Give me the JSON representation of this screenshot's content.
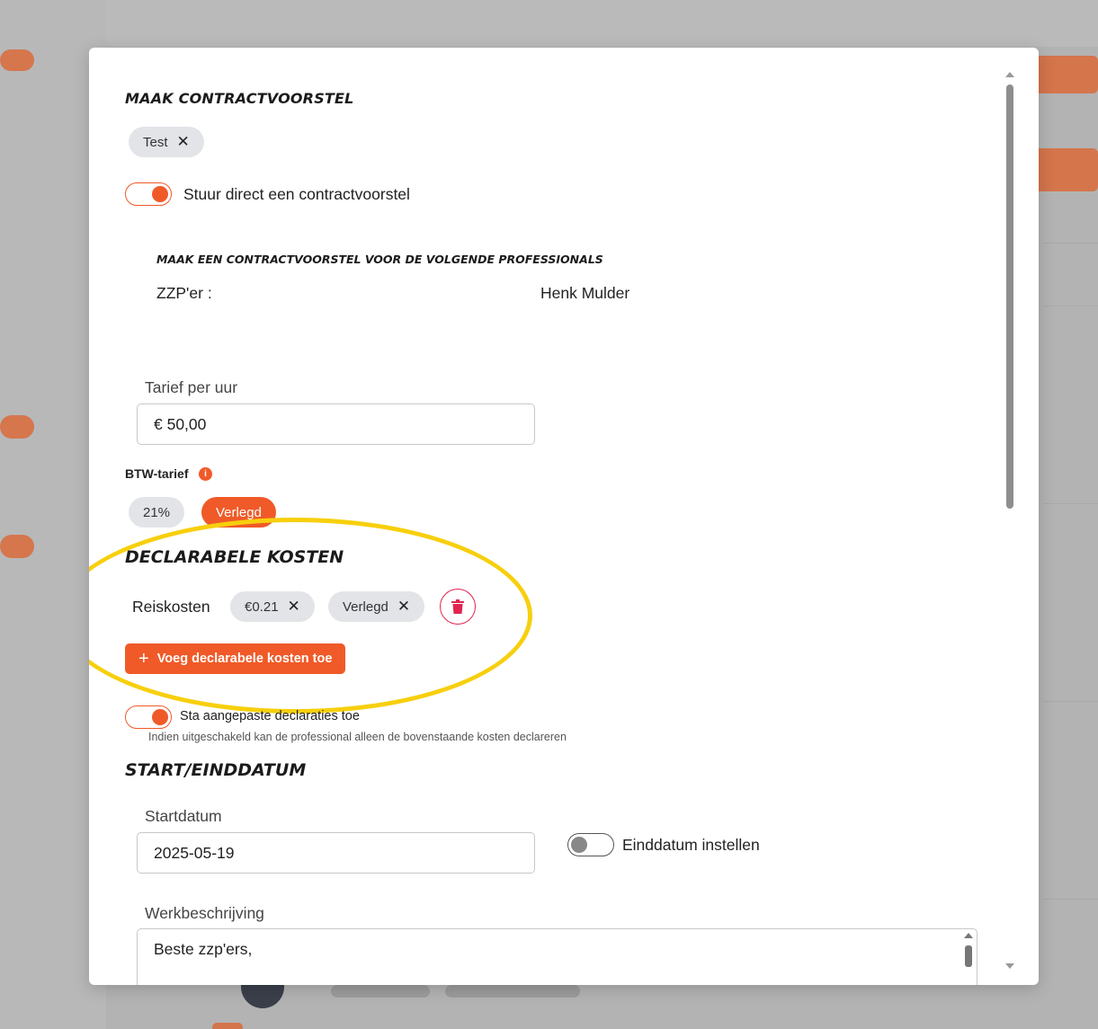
{
  "modal": {
    "title": "MAAK CONTRACTVOORSTEL",
    "selected_chip": {
      "label": "Test",
      "remove": "✕"
    },
    "send_toggle": {
      "label": "Stuur direct een contractvoorstel",
      "on": true
    },
    "professionals": {
      "heading": "MAAK EEN CONTRACTVOORSTEL VOOR DE VOLGENDE PROFESSIONALS",
      "role_label": "ZZP'er :",
      "name": "Henk Mulder"
    },
    "rate": {
      "label": "Tarief per uur",
      "value": "€ 50,00"
    },
    "vat": {
      "label": "BTW-tarief",
      "info": "i",
      "options": [
        "21%",
        "Verlegd"
      ],
      "selected": "Verlegd"
    },
    "expenses": {
      "heading": "DECLARABELE KOSTEN",
      "items": [
        {
          "name": "Reiskosten",
          "amount": "€0.21",
          "vat": "Verlegd"
        }
      ],
      "remove": "✕",
      "add_label": "Voeg declarabele kosten toe",
      "add_icon": "+"
    },
    "custom_claims": {
      "label": "Sta aangepaste declaraties toe",
      "hint": "Indien uitgeschakeld kan de professional alleen de bovenstaande kosten declareren",
      "on": true
    },
    "dates": {
      "heading": "START/EINDDATUM",
      "start_label": "Startdatum",
      "start_value": "2025-05-19",
      "end_toggle_label": "Einddatum instellen",
      "end_on": false
    },
    "description": {
      "label": "Werkbeschrijving",
      "value": "Beste zzp'ers,"
    }
  },
  "colors": {
    "accent": "#f05a28",
    "danger": "#e0244f",
    "chip": "#e2e4e8",
    "highlight": "#f7cf0d"
  },
  "icons": {
    "trash": "trash-icon",
    "info": "info-icon",
    "close": "close-icon",
    "plus": "plus-icon"
  }
}
